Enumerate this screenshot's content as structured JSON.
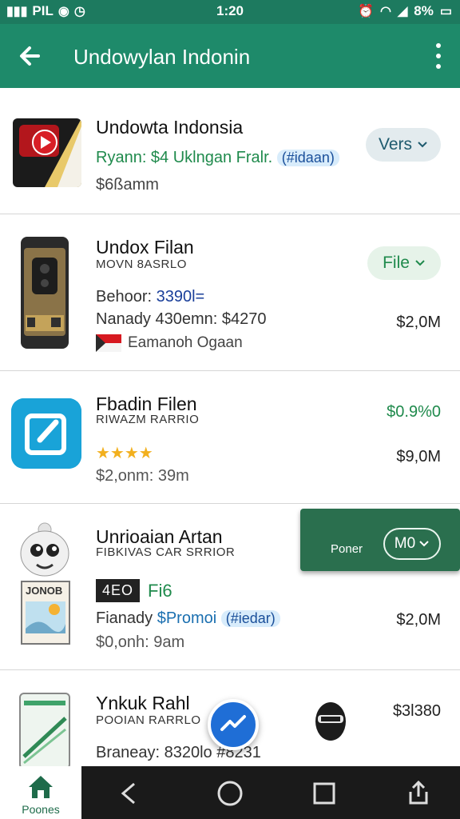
{
  "status_bar": {
    "left_text": "PIL",
    "time": "1:20",
    "battery": "8%"
  },
  "app_bar": {
    "title": "Undowylan Indonin"
  },
  "rows": [
    {
      "title": "Undowta Indonsia",
      "line1_green": "Ryann: $4 Uklngan Fralr.",
      "line1_chip": "(#idaan)",
      "line2": "$6ßamm",
      "button_label": "Vers"
    },
    {
      "title": "Undox Filan",
      "subtitle": "MOVN 8ASRLO",
      "line1_prefix": "Behoor:",
      "line1_value": "3390l=",
      "line2": "Nanady 430emn: $4270",
      "line3": "Eamanoh Ogaan",
      "price": "$2,0M",
      "button_label": "File"
    },
    {
      "title": "Fbadin Filen",
      "subtitle": "RIWAZM RARRIO",
      "rating": "★★★★",
      "line2": "$2,onm: 39m",
      "price_top": "$0.9%0",
      "price": "$9,0M"
    },
    {
      "title": "Unrioaian Artan",
      "subtitle": "FIBKIVAS CAR SRRIOR",
      "badge": "4EO",
      "badge_text": "Fi6",
      "line2_prefix": "Fianady",
      "line2_chip_text": "$Promoi",
      "line2_chip": "(#iedar)",
      "line3": "$0,onh: 9am",
      "price": "$2,0M",
      "overlay_label": "Poner",
      "overlay_button": "M0",
      "thumb_label": "JONOB"
    },
    {
      "title": "Ynkuk Rahl",
      "subtitle": "POOIAN RARRLO",
      "line1": "Braneay: 8320lo",
      "line1_tail": "#8231",
      "price": "$3l380"
    }
  ],
  "bottom_nav": {
    "home_label": "Poones"
  },
  "colors": {
    "status_bar": "#1d7a5f",
    "app_bar": "#1e8a6a",
    "accent_green": "#1f8a4c",
    "overlay_green": "#2a6f4e",
    "fab_blue": "#1f6ed6"
  }
}
